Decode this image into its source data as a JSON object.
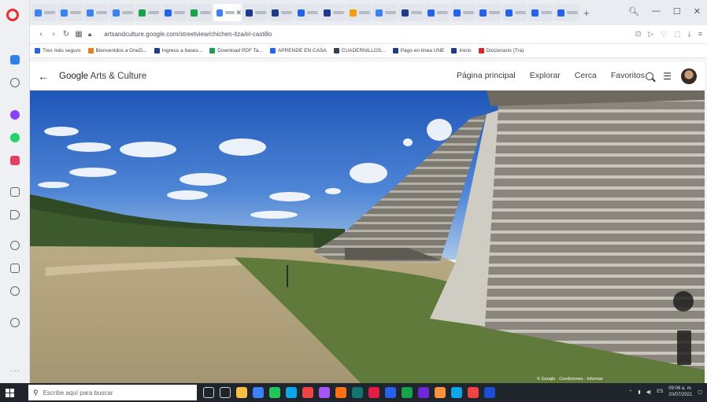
{
  "browser": {
    "url": "artsandculture.google.com/streetview/chichen-itza/el-castillo",
    "tabs": [
      {
        "favicon_color": "#3b82f6"
      },
      {
        "favicon_color": "#3b82f6"
      },
      {
        "favicon_color": "#3b82f6"
      },
      {
        "favicon_color": "#3b82f6"
      },
      {
        "favicon_color": "#16a34a"
      },
      {
        "favicon_color": "#2563eb"
      },
      {
        "favicon_color": "#16a34a"
      },
      {
        "favicon_color": "#3b82f6",
        "active": true
      },
      {
        "favicon_color": "#1e3a8a"
      },
      {
        "favicon_color": "#1e3a8a"
      },
      {
        "favicon_color": "#2563eb"
      },
      {
        "favicon_color": "#1e3a8a"
      },
      {
        "favicon_color": "#f59e0b"
      },
      {
        "favicon_color": "#3b82f6"
      },
      {
        "favicon_color": "#1e3a8a"
      },
      {
        "favicon_color": "#2563eb"
      },
      {
        "favicon_color": "#2563eb"
      },
      {
        "favicon_color": "#2563eb"
      },
      {
        "favicon_color": "#2563eb"
      },
      {
        "favicon_color": "#2563eb"
      },
      {
        "favicon_color": "#2563eb"
      }
    ],
    "bookmarks": [
      {
        "label": "Tres más seguro",
        "color": "#2563eb"
      },
      {
        "label": "Bienvenidos a OneD...",
        "color": "#e67e22"
      },
      {
        "label": "Ingreso a bases...",
        "color": "#1e3a8a"
      },
      {
        "label": "Download PDF Ta...",
        "color": "#16a34a"
      },
      {
        "label": "APRENDE EN CASA",
        "color": "#2563eb"
      },
      {
        "label": "CUADERNILLOS...",
        "color": "#374151"
      },
      {
        "label": "Pago en línea UNE",
        "color": "#1e3a8a"
      },
      {
        "label": "Inicio",
        "color": "#1e3a8a"
      },
      {
        "label": "Diccionario (Tra)",
        "color": "#dc2626"
      }
    ]
  },
  "site": {
    "logo_google": "Google",
    "logo_rest": "Arts & Culture",
    "nav": [
      "Página principal",
      "Explorar",
      "Cerca",
      "Favoritos"
    ]
  },
  "taskbar": {
    "search_placeholder": "Escribe aquí para buscar",
    "time": "09:06 a. m.",
    "date": "20/07/2021",
    "apps": [
      "#f4c04a",
      "#3b82f6",
      "#22c55e",
      "#0ea5e9",
      "#ef4444",
      "#a855f7",
      "#f97316",
      "#0f766e",
      "#e11d48",
      "#2563eb",
      "#16a34a",
      "#6d28d9",
      "#fb923c",
      "#0ea5e9",
      "#ef4444",
      "#1d4ed8"
    ]
  }
}
